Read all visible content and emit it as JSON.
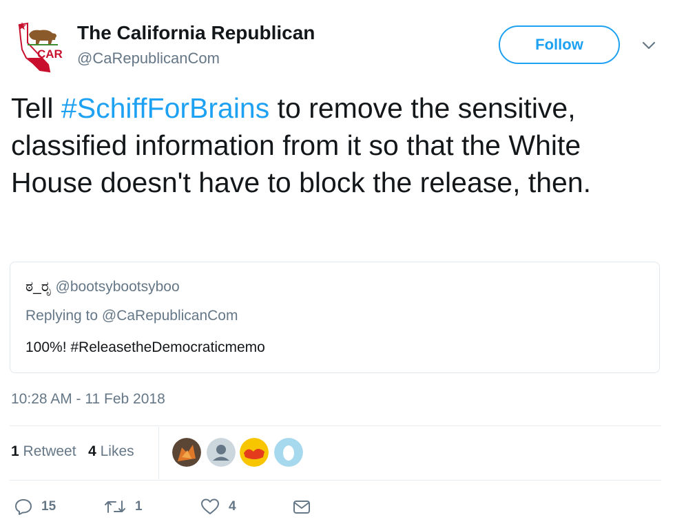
{
  "tweet": {
    "author_name": "The California Republican",
    "author_handle": "@CaRepublicanCom",
    "logo_text": "CAR",
    "follow_label": "Follow",
    "text_before": "Tell ",
    "hashtag": "#SchiffForBrains",
    "text_after": " to remove the sensitive, classified information from it so that the White House doesn't have to block the release, then.",
    "timestamp": "10:28 AM - 11 Feb 2018"
  },
  "quoted": {
    "name": "ಠ_ರೃ",
    "handle": "@bootsybootsyboo",
    "replying_to": "Replying to @CaRepublicanCom",
    "text": "100%! #ReleasetheDemocraticmemo"
  },
  "stats": {
    "retweet_count": "1",
    "retweet_label": "Retweet",
    "like_count": "4",
    "like_label": "Likes"
  },
  "actions": {
    "reply_count": "15",
    "retweet_count": "1",
    "like_count": "4"
  },
  "colors": {
    "accent": "#1da1f2",
    "secondary_text": "#657786",
    "border": "#e1e8ed"
  }
}
